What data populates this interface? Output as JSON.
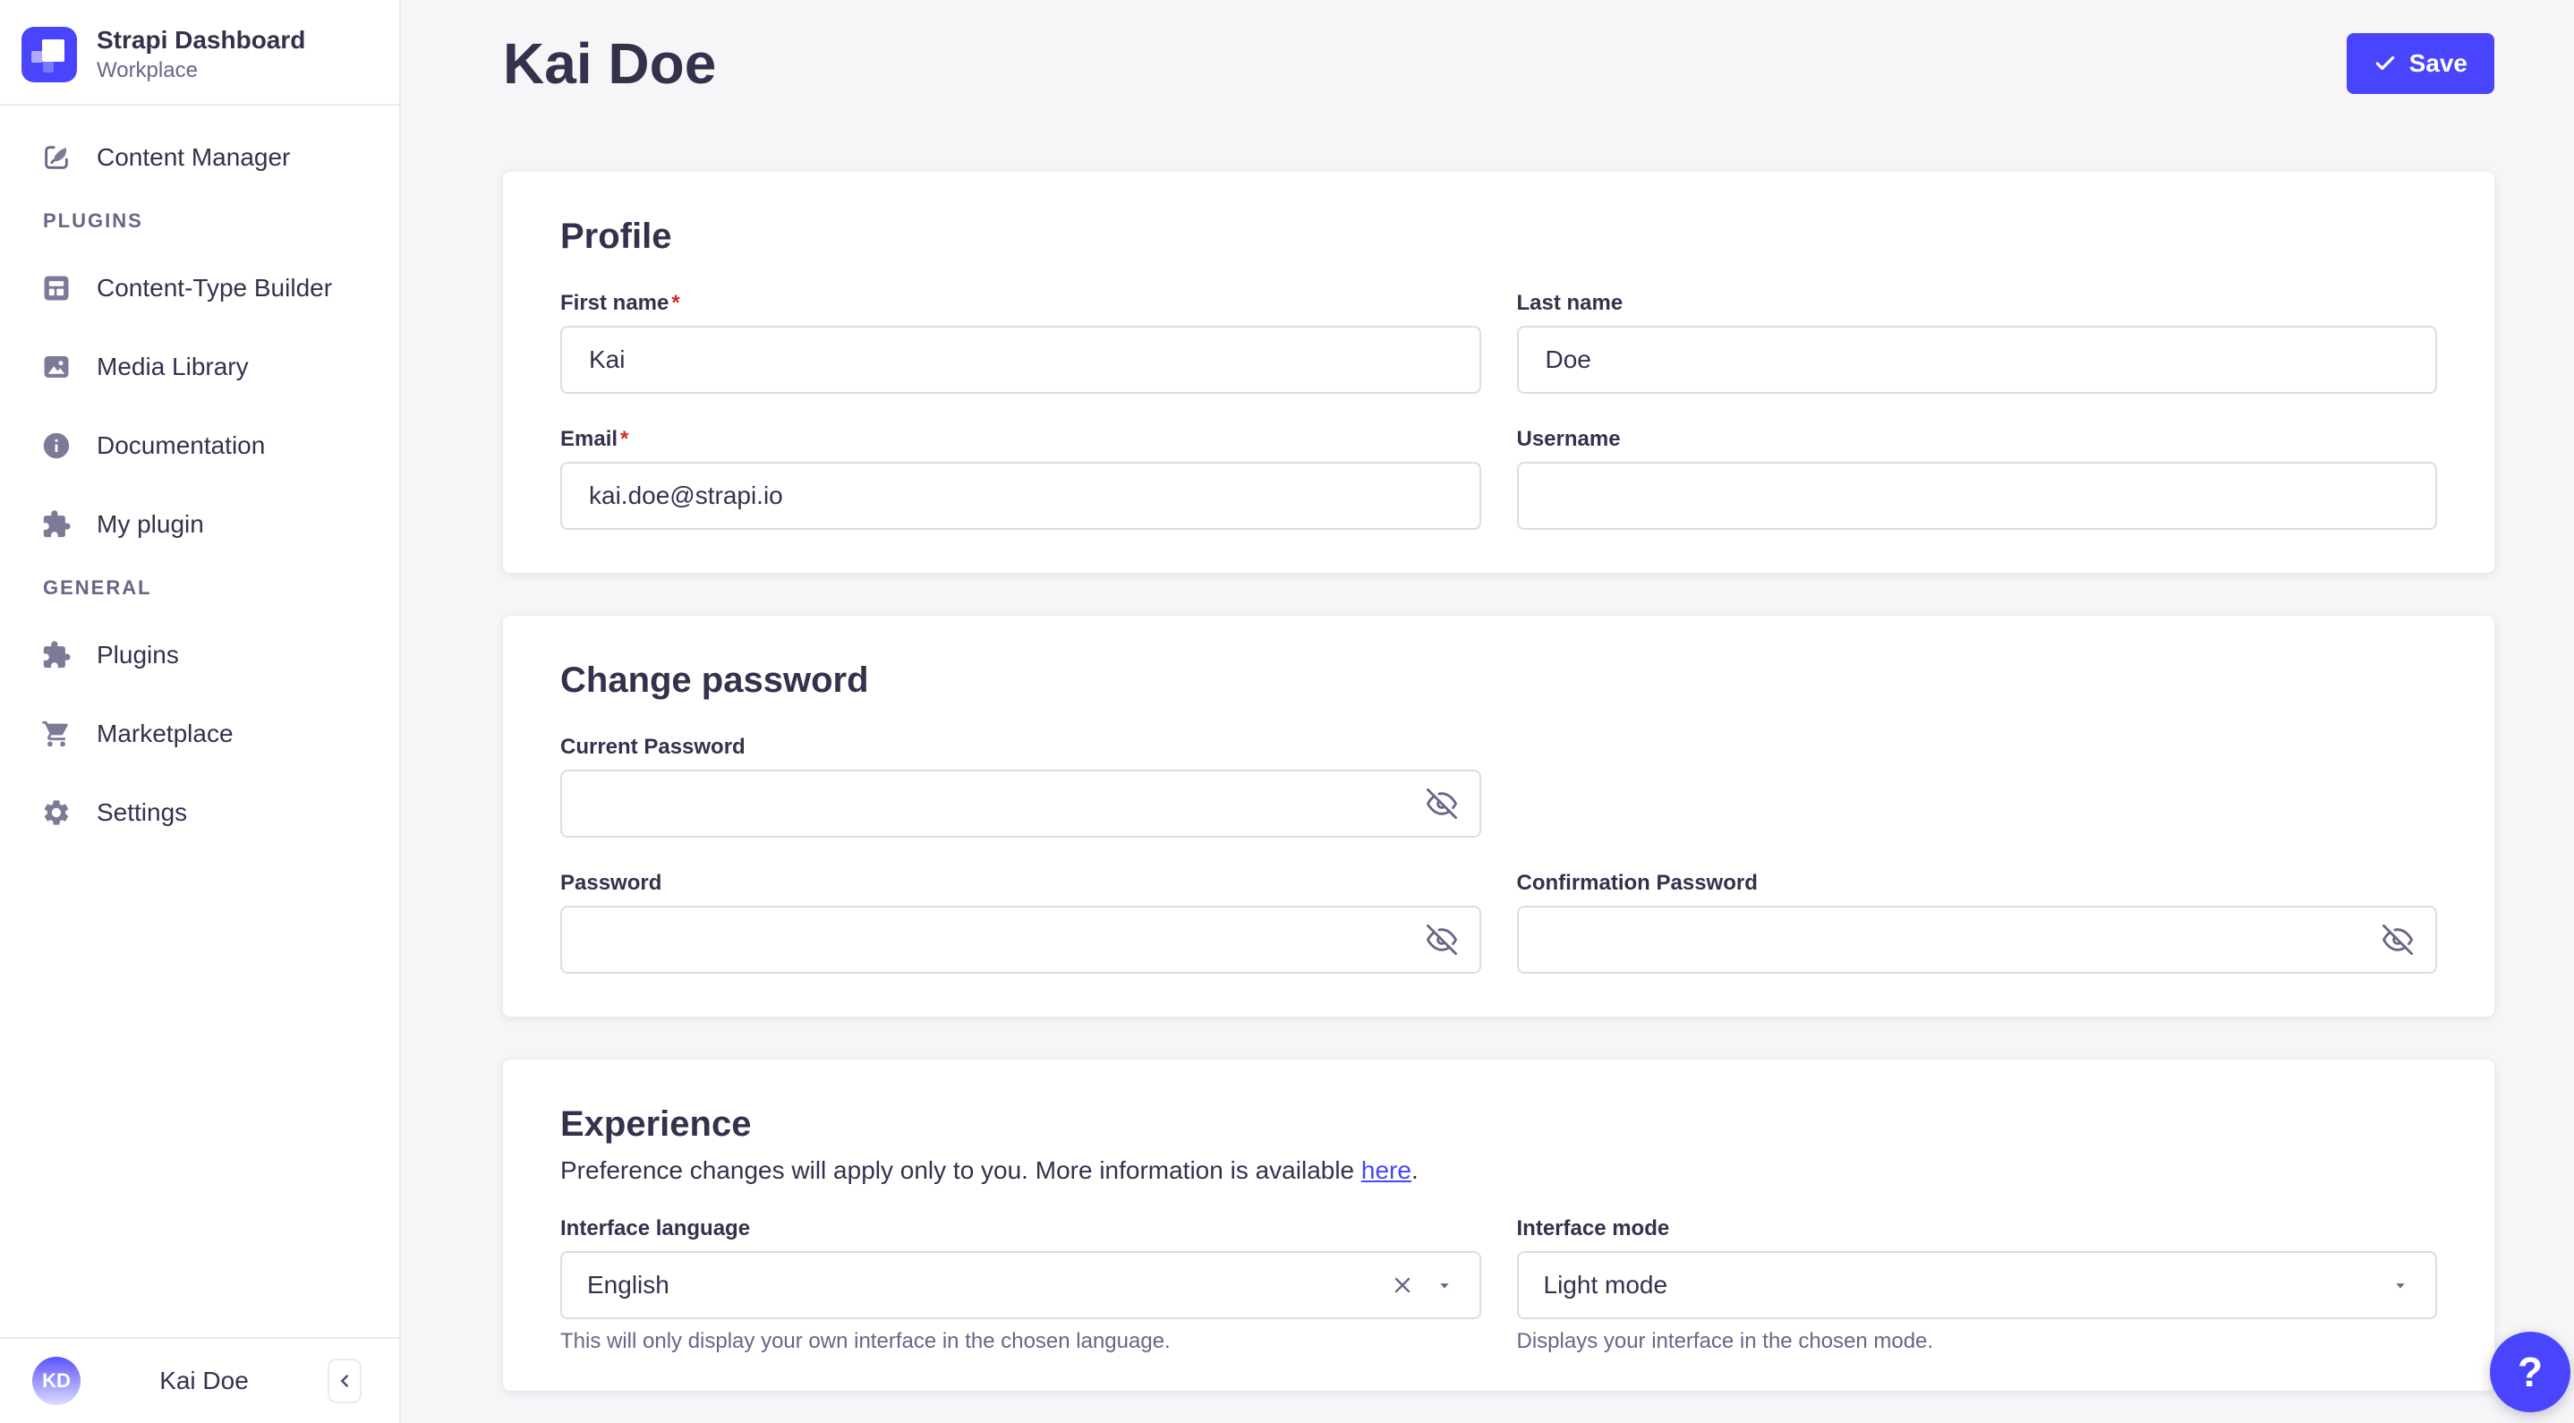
{
  "ui": {
    "required_mark": "*"
  },
  "colors": {
    "primary": "#4945ff",
    "danger": "#d02b20",
    "background": "#f6f6f9",
    "surface": "#ffffff",
    "text": "#32324d",
    "text_subtle": "#666687",
    "border": "#dcdce4"
  },
  "sidebar": {
    "brand": {
      "title": "Strapi Dashboard",
      "subtitle": "Workplace",
      "logo_icon": "strapi-logo"
    },
    "items_top": [
      {
        "label": "Content Manager",
        "icon": "feather-edit-icon"
      }
    ],
    "sections": [
      {
        "label": "PLUGINS",
        "items": [
          {
            "label": "Content-Type Builder",
            "icon": "layout-icon"
          },
          {
            "label": "Media Library",
            "icon": "image-icon"
          },
          {
            "label": "Documentation",
            "icon": "info-icon"
          },
          {
            "label": "My plugin",
            "icon": "puzzle-icon"
          }
        ]
      },
      {
        "label": "GENERAL",
        "items": [
          {
            "label": "Plugins",
            "icon": "puzzle-icon"
          },
          {
            "label": "Marketplace",
            "icon": "cart-icon"
          },
          {
            "label": "Settings",
            "icon": "gear-icon"
          }
        ]
      }
    ],
    "user": {
      "initials": "KD",
      "name": "Kai Doe",
      "collapse_icon": "chevron-left-icon"
    }
  },
  "header": {
    "title": "Kai Doe",
    "save_label": "Save",
    "save_icon": "check-icon"
  },
  "profile_card": {
    "title": "Profile",
    "fields": {
      "first_name": {
        "label": "First name",
        "required": true,
        "value": "Kai"
      },
      "last_name": {
        "label": "Last name",
        "required": false,
        "value": "Doe"
      },
      "email": {
        "label": "Email",
        "required": true,
        "value": "kai.doe@strapi.io"
      },
      "username": {
        "label": "Username",
        "required": false,
        "value": ""
      }
    }
  },
  "password_card": {
    "title": "Change password",
    "toggle_icon": "eye-slash-icon",
    "fields": {
      "current": {
        "label": "Current Password",
        "value": ""
      },
      "new": {
        "label": "Password",
        "value": ""
      },
      "confirm": {
        "label": "Confirmation Password",
        "value": ""
      }
    }
  },
  "experience_card": {
    "title": "Experience",
    "description_prefix": "Preference changes will apply only to you. More information is available ",
    "link_text": "here",
    "description_suffix": ".",
    "language": {
      "label": "Interface language",
      "value": "English",
      "clear_icon": "x-icon",
      "caret_icon": "caret-down-icon",
      "helper": "This will only display your own interface in the chosen language."
    },
    "mode": {
      "label": "Interface mode",
      "value": "Light mode",
      "caret_icon": "caret-down-icon",
      "helper": "Displays your interface in the chosen mode."
    }
  },
  "help": {
    "label": "?"
  }
}
